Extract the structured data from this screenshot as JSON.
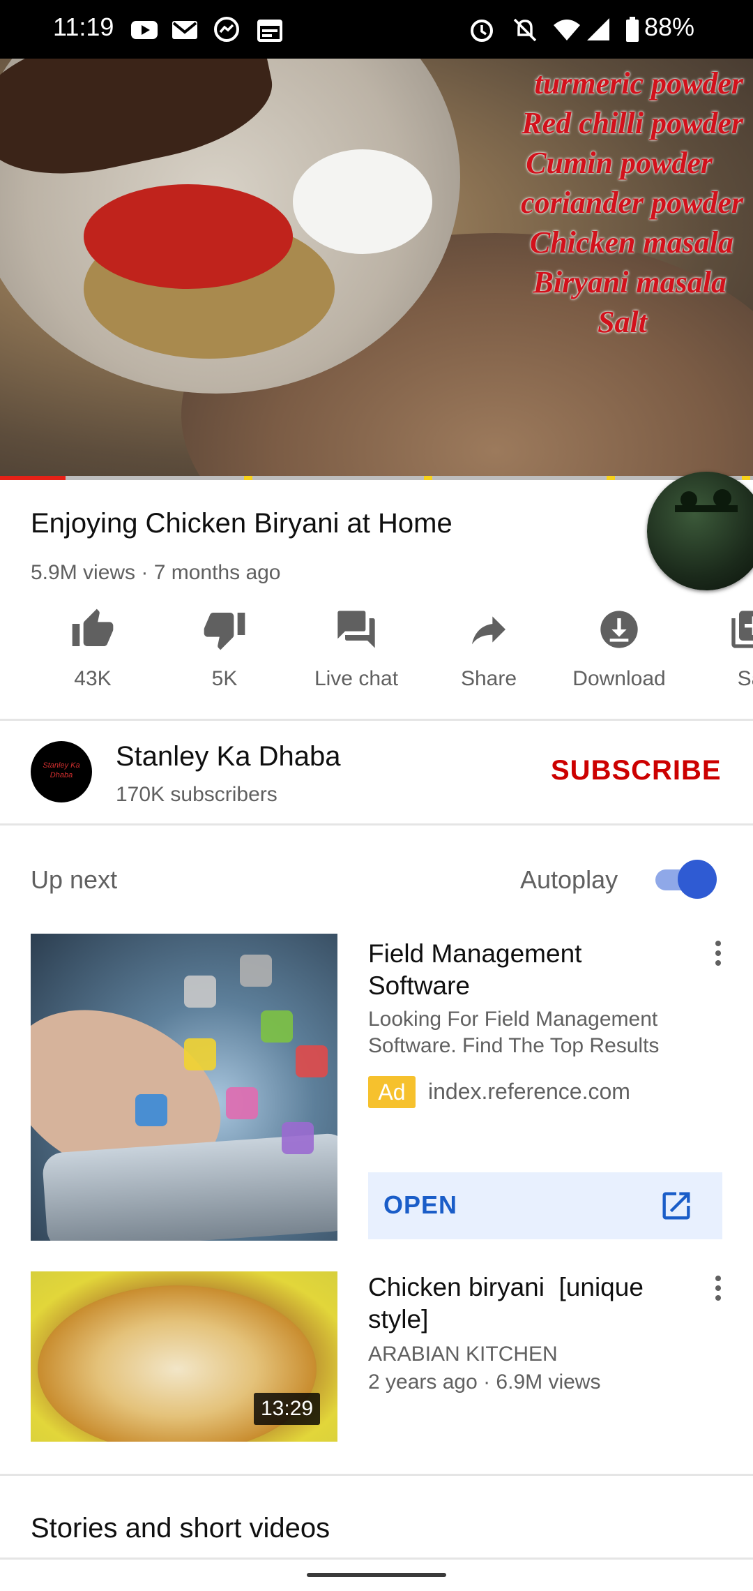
{
  "status_bar": {
    "time": "11:19",
    "battery": "88%",
    "left_icons": [
      "youtube-icon",
      "gmail-icon",
      "messenger-icon",
      "calendar-icon"
    ],
    "right_icons": [
      "alarm-icon",
      "mute-icon",
      "wifi-icon",
      "signal-icon",
      "battery-icon"
    ]
  },
  "player": {
    "overlay_lines": [
      "turmeric powder",
      "Red chilli powder",
      "Cumin powder",
      "coriander powder",
      "Chicken masala",
      "Biryani masala",
      "Salt"
    ],
    "progress_fraction": 0.087,
    "progress_color": "#e62117",
    "ad_marker_color": "#f7d21a"
  },
  "video": {
    "title": "Enjoying Chicken Biryani at Home",
    "meta": "5.9M views · 7 months ago"
  },
  "actions": [
    {
      "icon": "thumbs-up-icon",
      "label": "43K"
    },
    {
      "icon": "thumbs-down-icon",
      "label": "5K"
    },
    {
      "icon": "live-chat-icon",
      "label": "Live chat"
    },
    {
      "icon": "share-icon",
      "label": "Share"
    },
    {
      "icon": "download-icon",
      "label": "Download"
    },
    {
      "icon": "save-icon",
      "label": "Sa"
    }
  ],
  "channel": {
    "name": "Stanley Ka Dhaba",
    "subscribers": "170K subscribers",
    "subscribe_label": "SUBSCRIBE",
    "avatar_text": "Stanley Ka Dhaba"
  },
  "up_next": {
    "label": "Up next",
    "autoplay_label": "Autoplay",
    "autoplay_on": true
  },
  "ad_card": {
    "title": "Field Management Software",
    "description": "Looking For Field Management Software. Find The Top Results",
    "badge": "Ad",
    "domain": "index.reference.com",
    "open_label": "OPEN"
  },
  "video_card": {
    "title": "Chicken biryani  [unique style]",
    "channel": "ARABIAN KITCHEN",
    "meta": "2 years ago · 6.9M views",
    "duration": "13:29"
  },
  "stories": {
    "heading": "Stories and short videos"
  },
  "colors": {
    "brand_red": "#cc0000",
    "link_blue": "#1a5dc8",
    "toggle_blue": "#2f5bd3",
    "ad_yellow": "#f6c12d"
  }
}
